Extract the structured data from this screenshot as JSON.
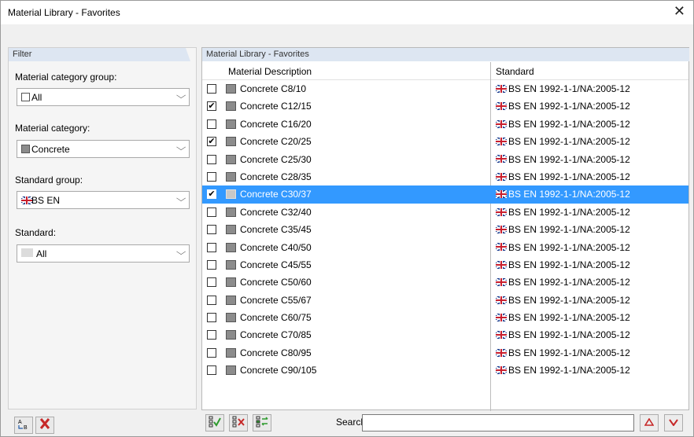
{
  "window": {
    "title": "Material Library - Favorites",
    "close_label": "✕"
  },
  "filter": {
    "header": "Filter",
    "category_group": {
      "label": "Material category group:",
      "value": "All"
    },
    "category": {
      "label": "Material category:",
      "value": "Concrete"
    },
    "standard_group": {
      "label": "Standard group:",
      "value": "BS EN"
    },
    "standard": {
      "label": "Standard:",
      "value": "All"
    }
  },
  "library": {
    "header": "Material Library - Favorites",
    "columns": {
      "description": "Material Description",
      "standard": "Standard"
    },
    "rows": [
      {
        "checked": false,
        "description": "Concrete C8/10",
        "standard": "BS EN 1992-1-1/NA:2005-12"
      },
      {
        "checked": true,
        "description": "Concrete C12/15",
        "standard": "BS EN 1992-1-1/NA:2005-12"
      },
      {
        "checked": false,
        "description": "Concrete C16/20",
        "standard": "BS EN 1992-1-1/NA:2005-12"
      },
      {
        "checked": true,
        "description": "Concrete C20/25",
        "standard": "BS EN 1992-1-1/NA:2005-12"
      },
      {
        "checked": false,
        "description": "Concrete C25/30",
        "standard": "BS EN 1992-1-1/NA:2005-12"
      },
      {
        "checked": false,
        "description": "Concrete C28/35",
        "standard": "BS EN 1992-1-1/NA:2005-12"
      },
      {
        "checked": true,
        "description": "Concrete C30/37",
        "standard": "BS EN 1992-1-1/NA:2005-12"
      },
      {
        "checked": false,
        "description": "Concrete C32/40",
        "standard": "BS EN 1992-1-1/NA:2005-12"
      },
      {
        "checked": false,
        "description": "Concrete C35/45",
        "standard": "BS EN 1992-1-1/NA:2005-12"
      },
      {
        "checked": false,
        "description": "Concrete C40/50",
        "standard": "BS EN 1992-1-1/NA:2005-12"
      },
      {
        "checked": false,
        "description": "Concrete C45/55",
        "standard": "BS EN 1992-1-1/NA:2005-12"
      },
      {
        "checked": false,
        "description": "Concrete C50/60",
        "standard": "BS EN 1992-1-1/NA:2005-12"
      },
      {
        "checked": false,
        "description": "Concrete C55/67",
        "standard": "BS EN 1992-1-1/NA:2005-12"
      },
      {
        "checked": false,
        "description": "Concrete C60/75",
        "standard": "BS EN 1992-1-1/NA:2005-12"
      },
      {
        "checked": false,
        "description": "Concrete C70/85",
        "standard": "BS EN 1992-1-1/NA:2005-12"
      },
      {
        "checked": false,
        "description": "Concrete C80/95",
        "standard": "BS EN 1992-1-1/NA:2005-12"
      },
      {
        "checked": false,
        "description": "Concrete C90/105",
        "standard": "BS EN 1992-1-1/NA:2005-12"
      }
    ],
    "selected_row": 6,
    "check_mark": "✔"
  },
  "bottom": {
    "search_label": "Search:",
    "search_value": ""
  },
  "colors": {
    "selection": "#3399ff",
    "panel_header": "#dde6f2",
    "nav_arrow": "#c62828"
  }
}
